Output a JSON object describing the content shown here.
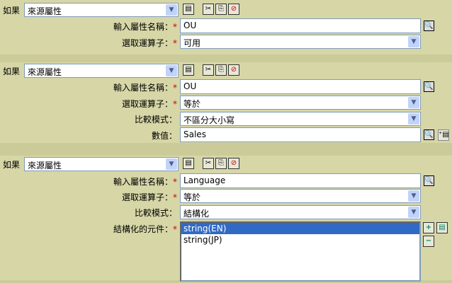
{
  "if_label": "如果",
  "source_attr": "來源屬性",
  "labels": {
    "attr_name": "輸入屬性名稱：",
    "operator": "選取運算子：",
    "compare_mode": "比較模式：",
    "value": "數值：",
    "structured": "結構化的元件："
  },
  "required_mark": "*",
  "conditions": [
    {
      "attr_name": "OU",
      "operator": "可用"
    },
    {
      "attr_name": "OU",
      "operator": "等於",
      "compare_mode": "不區分大小寫",
      "value": "Sales"
    },
    {
      "attr_name": "Language",
      "operator": "等於",
      "compare_mode": "結構化",
      "components": [
        "string(EN)",
        "string(JP)"
      ]
    }
  ]
}
